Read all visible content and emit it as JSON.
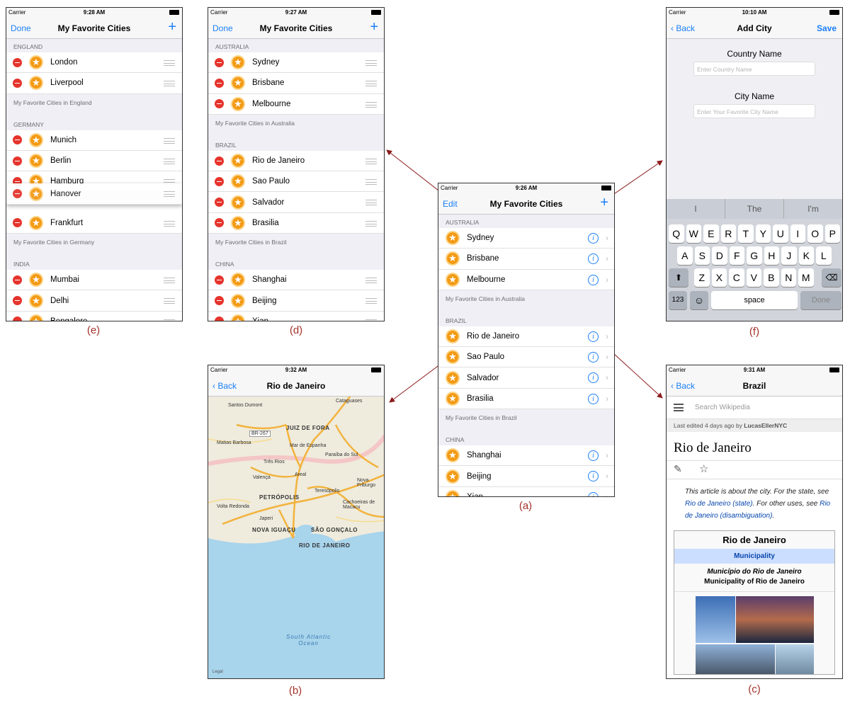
{
  "colors": {
    "accent": "#1a7ff6",
    "delete": "#e5342c",
    "star": "#f39a14",
    "caption": "#a3322a",
    "arrow": "#8b1a1a"
  },
  "status": {
    "carrier": "Carrier"
  },
  "a": {
    "time": "9:26 AM",
    "edit": "Edit",
    "title": "My Favorite Cities",
    "add": "+",
    "sections": [
      {
        "header": "AUSTRALIA",
        "cities": [
          "Sydney",
          "Brisbane",
          "Melbourne"
        ],
        "footer": "My Favorite Cities in Australia"
      },
      {
        "header": "BRAZIL",
        "cities": [
          "Rio de Janeiro",
          "Sao Paulo",
          "Salvador",
          "Brasilia"
        ],
        "footer": "My Favorite Cities in Brazil"
      },
      {
        "header": "CHINA",
        "cities": [
          "Shanghai",
          "Beijing",
          "Xian"
        ],
        "footer": ""
      }
    ],
    "caption": "(a)"
  },
  "b": {
    "time": "9:32 AM",
    "back": "Back",
    "title": "Rio de Janeiro",
    "legal": "Legal",
    "ocean": "South Atlantic\nOcean",
    "places": [
      "Cataguases",
      "Santos Dumont",
      "JUIZ DE FORA",
      "BR-267",
      "Matias Barbosa",
      "Mar de Espanha",
      "Três Rios",
      "Paraíba do Sul",
      "Areal",
      "Valença",
      "PETRÓPOLIS",
      "Teresópolis",
      "Volta Redonda",
      "Japeri",
      "NOVA IGUAÇU",
      "SÃO GONÇALO",
      "RIO DE JANEIRO",
      "Cachoeiras de Macacu",
      "Nova Friburgo"
    ],
    "caption": "(b)"
  },
  "c": {
    "time": "9:31 AM",
    "back": "Back",
    "title": "Brazil",
    "search": "Search Wikipedia",
    "edited_prefix": "Last edited 4 days ago by ",
    "edited_user": "LucasEllerNYC",
    "article": "Rio de Janeiro",
    "hat_1": "This article is about the city. For the state, see ",
    "hat_link1": "Rio de Janeiro (state)",
    "hat_2": ". For other uses, see ",
    "hat_link2": "Rio de Janeiro (disambiguation)",
    "hat_3": ".",
    "box_title": "Rio de Janeiro",
    "box_type": "Municipality",
    "box_pt": "Município do Rio de Janeiro",
    "box_en": "Municipality of Rio de Janeiro",
    "caption": "(c)"
  },
  "d": {
    "time": "9:27 AM",
    "done": "Done",
    "title": "My Favorite Cities",
    "add": "+",
    "sections": [
      {
        "header": "AUSTRALIA",
        "cities": [
          "Sydney",
          "Brisbane",
          "Melbourne"
        ],
        "footer": "My Favorite Cities in Australia"
      },
      {
        "header": "BRAZIL",
        "cities": [
          "Rio de Janeiro",
          "Sao Paulo",
          "Salvador",
          "Brasilia"
        ],
        "footer": "My Favorite Cities in Brazil"
      },
      {
        "header": "CHINA",
        "cities": [
          "Shanghai",
          "Beijing",
          "Xian"
        ],
        "footer": ""
      }
    ],
    "caption": "(d)"
  },
  "e": {
    "time": "9:28 AM",
    "done": "Done",
    "title": "My Favorite Cities",
    "add": "+",
    "england": {
      "header": "ENGLAND",
      "cities": [
        "London",
        "Liverpool"
      ],
      "footer": "My Favorite Cities in England"
    },
    "germany": {
      "header": "GERMANY",
      "cities": [
        "Munich",
        "Berlin",
        "Hamburg",
        "Hanover",
        "Frankfurt"
      ],
      "footer": "My Favorite Cities in Germany"
    },
    "india": {
      "header": "INDIA",
      "cities": [
        "Mumbai",
        "Delhi",
        "Bengalore"
      ]
    },
    "caption": "(e)"
  },
  "f": {
    "time": "10:10 AM",
    "back": "Back",
    "title": "Add City",
    "save": "Save",
    "country_label": "Country Name",
    "country_ph": "Enter Country Name",
    "city_label": "City Name",
    "city_ph": "Enter Your Favorite City Name",
    "suggestions": [
      "I",
      "The",
      "I'm"
    ],
    "row1": [
      "Q",
      "W",
      "E",
      "R",
      "T",
      "Y",
      "U",
      "I",
      "O",
      "P"
    ],
    "row2": [
      "A",
      "S",
      "D",
      "F",
      "G",
      "H",
      "J",
      "K",
      "L"
    ],
    "row3": [
      "Z",
      "X",
      "C",
      "V",
      "B",
      "N",
      "M"
    ],
    "num": "123",
    "space": "space",
    "done": "Done",
    "caption": "(f)"
  }
}
